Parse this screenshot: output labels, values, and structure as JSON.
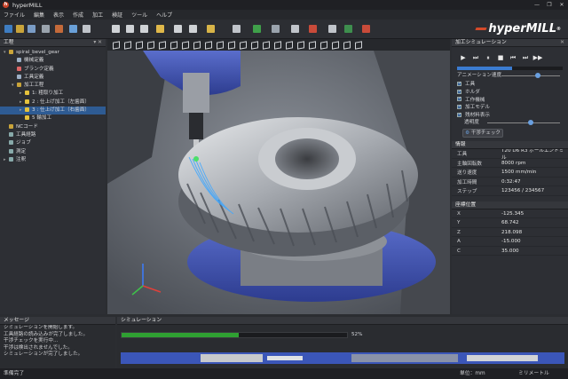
{
  "app": {
    "title": "hyperMILL",
    "logo_letter": "h"
  },
  "window_controls": [
    "—",
    "❐",
    "✕"
  ],
  "menu": [
    "ファイル",
    "編集",
    "表示",
    "作成",
    "加工",
    "検証",
    "ツール",
    "ヘルプ"
  ],
  "brand": "hyperMILL",
  "left_panel": {
    "title": "工程",
    "items": [
      {
        "label": "spiral_bevel_gear",
        "indent": 0,
        "arrow": "▾",
        "icon_color": "#c9a43a"
      },
      {
        "label": "機械定義",
        "indent": 1,
        "arrow": "",
        "icon_color": "#9db0c6"
      },
      {
        "label": "ブランク定義",
        "indent": 1,
        "arrow": "",
        "icon_color": "#d66"
      },
      {
        "label": "工具定義",
        "indent": 1,
        "arrow": "",
        "icon_color": "#9db0c6"
      },
      {
        "label": "加工工程",
        "indent": 1,
        "arrow": "▾",
        "icon_color": "#c9a43a"
      },
      {
        "label": "1: 粗取り加工",
        "indent": 2,
        "arrow": "▸",
        "icon_color": "#e6c23c"
      },
      {
        "label": "2 : 仕上げ加工（左歯面）",
        "indent": 2,
        "arrow": "▸",
        "icon_color": "#e6c23c"
      },
      {
        "label": "3 : 仕上げ加工（右歯面）",
        "indent": 2,
        "arrow": "▸",
        "icon_color": "#e6c23c",
        "selected": true
      },
      {
        "label": "5 輪加工",
        "indent": 2,
        "arrow": "",
        "icon_color": "#e6c23c"
      },
      {
        "label": "NCコード",
        "indent": 0,
        "arrow": "",
        "icon_color": "#c9a43a"
      },
      {
        "label": "工具経路",
        "indent": 0,
        "arrow": "",
        "icon_color": "#8aa"
      },
      {
        "label": "ジョブ",
        "indent": 0,
        "arrow": "",
        "icon_color": "#8aa"
      },
      {
        "label": "測定",
        "indent": 0,
        "arrow": "",
        "icon_color": "#8aa"
      },
      {
        "label": "注釈",
        "indent": 0,
        "arrow": "▸",
        "icon_color": "#8aa"
      }
    ]
  },
  "right_panel": {
    "title": "加工シミュレーション",
    "controls": [
      "▶",
      "⏭",
      "⏸",
      "■",
      "⏮",
      "⏭",
      "▶▶"
    ],
    "anim_speed_label": "アニメーション速度",
    "checks": [
      "工具",
      "ホルダ",
      "工作機械",
      "加工モデル",
      "残材料表示"
    ],
    "transparency_label": "透明度",
    "interference_button": "干渉チェック",
    "info_title": "情報",
    "info": [
      {
        "k": "工具",
        "v": "T20 D6 R3 ボールエンドミル"
      },
      {
        "k": "主軸回転数",
        "v": "8000 rpm"
      },
      {
        "k": "送り速度",
        "v": "1500 mm/min"
      },
      {
        "k": "加工時間",
        "v": "0:32:47"
      },
      {
        "k": "ステップ",
        "v": "123456 / 234567"
      }
    ],
    "coord_title": "座標位置",
    "coords": [
      {
        "k": "X",
        "v": "-125.345"
      },
      {
        "k": "Y",
        "v": "68.742"
      },
      {
        "k": "Z",
        "v": "218.098"
      },
      {
        "k": "A",
        "v": "-15.000"
      },
      {
        "k": "C",
        "v": "35.000"
      }
    ]
  },
  "messages": {
    "title": "メッセージ",
    "lines": [
      "シミュレーションを開始します。",
      "工具経路の読み込みが完了しました。",
      "干渉チェックを実行中...",
      "干渉は検出されませんでした。",
      "シミュレーションが完了しました。"
    ]
  },
  "simulation": {
    "title": "シミュレーション",
    "progress": 0.52,
    "progress_label": "52%"
  },
  "status": {
    "ready": "準備完了",
    "unit_label": "単位：mm",
    "unit": "ミリメートル"
  },
  "colors": {
    "accent": "#2e5b93",
    "progress": "#2fa032",
    "brand_red": "#d44a2a"
  }
}
